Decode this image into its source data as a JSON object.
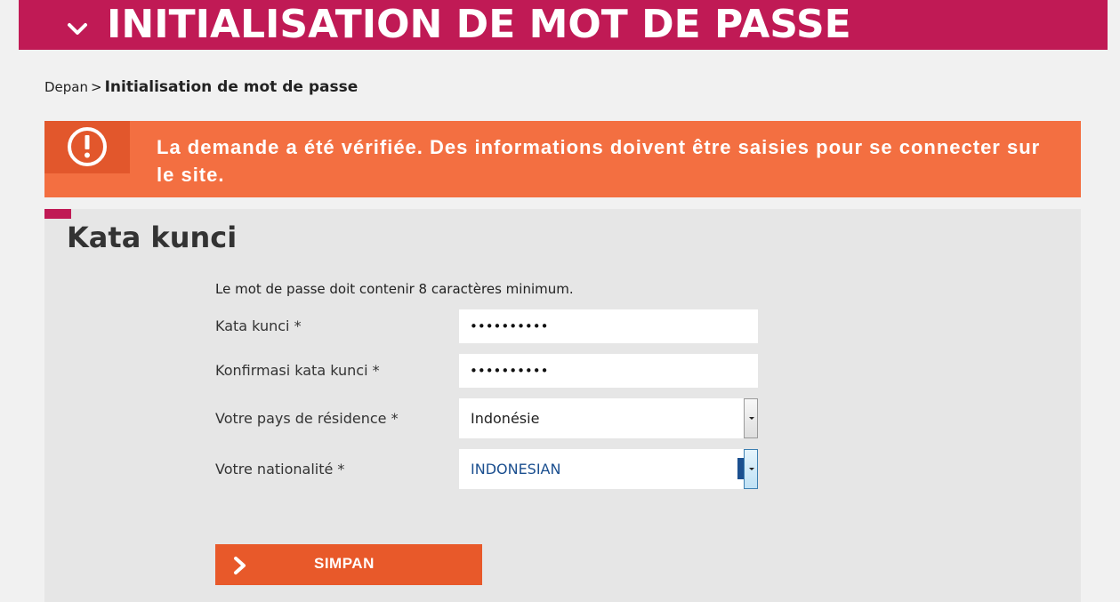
{
  "header": {
    "title": "INITIALISATION DE MOT DE PASSE",
    "icon": "chevron-down-icon",
    "color": "#c01a55"
  },
  "breadcrumb": {
    "home": "Depan",
    "separator": ">",
    "current": "Initialisation de mot de passe"
  },
  "alert": {
    "icon": "exclamation-circle-icon",
    "message": "La demande a été vérifiée. Des informations doivent être saisies pour se connecter sur le site.",
    "color": "#f36f41"
  },
  "form": {
    "title": "Kata kunci",
    "hint": "Le mot de passe doit contenir 8 caractères minimum.",
    "fields": {
      "password": {
        "label": "Kata kunci *",
        "value": "••••••••••"
      },
      "password_confirm": {
        "label": "Konfirmasi kata kunci *",
        "value": "••••••••••"
      },
      "country": {
        "label": "Votre pays de résidence *",
        "value": "Indonésie"
      },
      "nationality": {
        "label": "Votre nationalité *",
        "value": "INDONESIAN"
      }
    },
    "submit": {
      "label": "SIMPAN",
      "icon": "chevron-right-icon",
      "color": "#e8592a"
    }
  }
}
